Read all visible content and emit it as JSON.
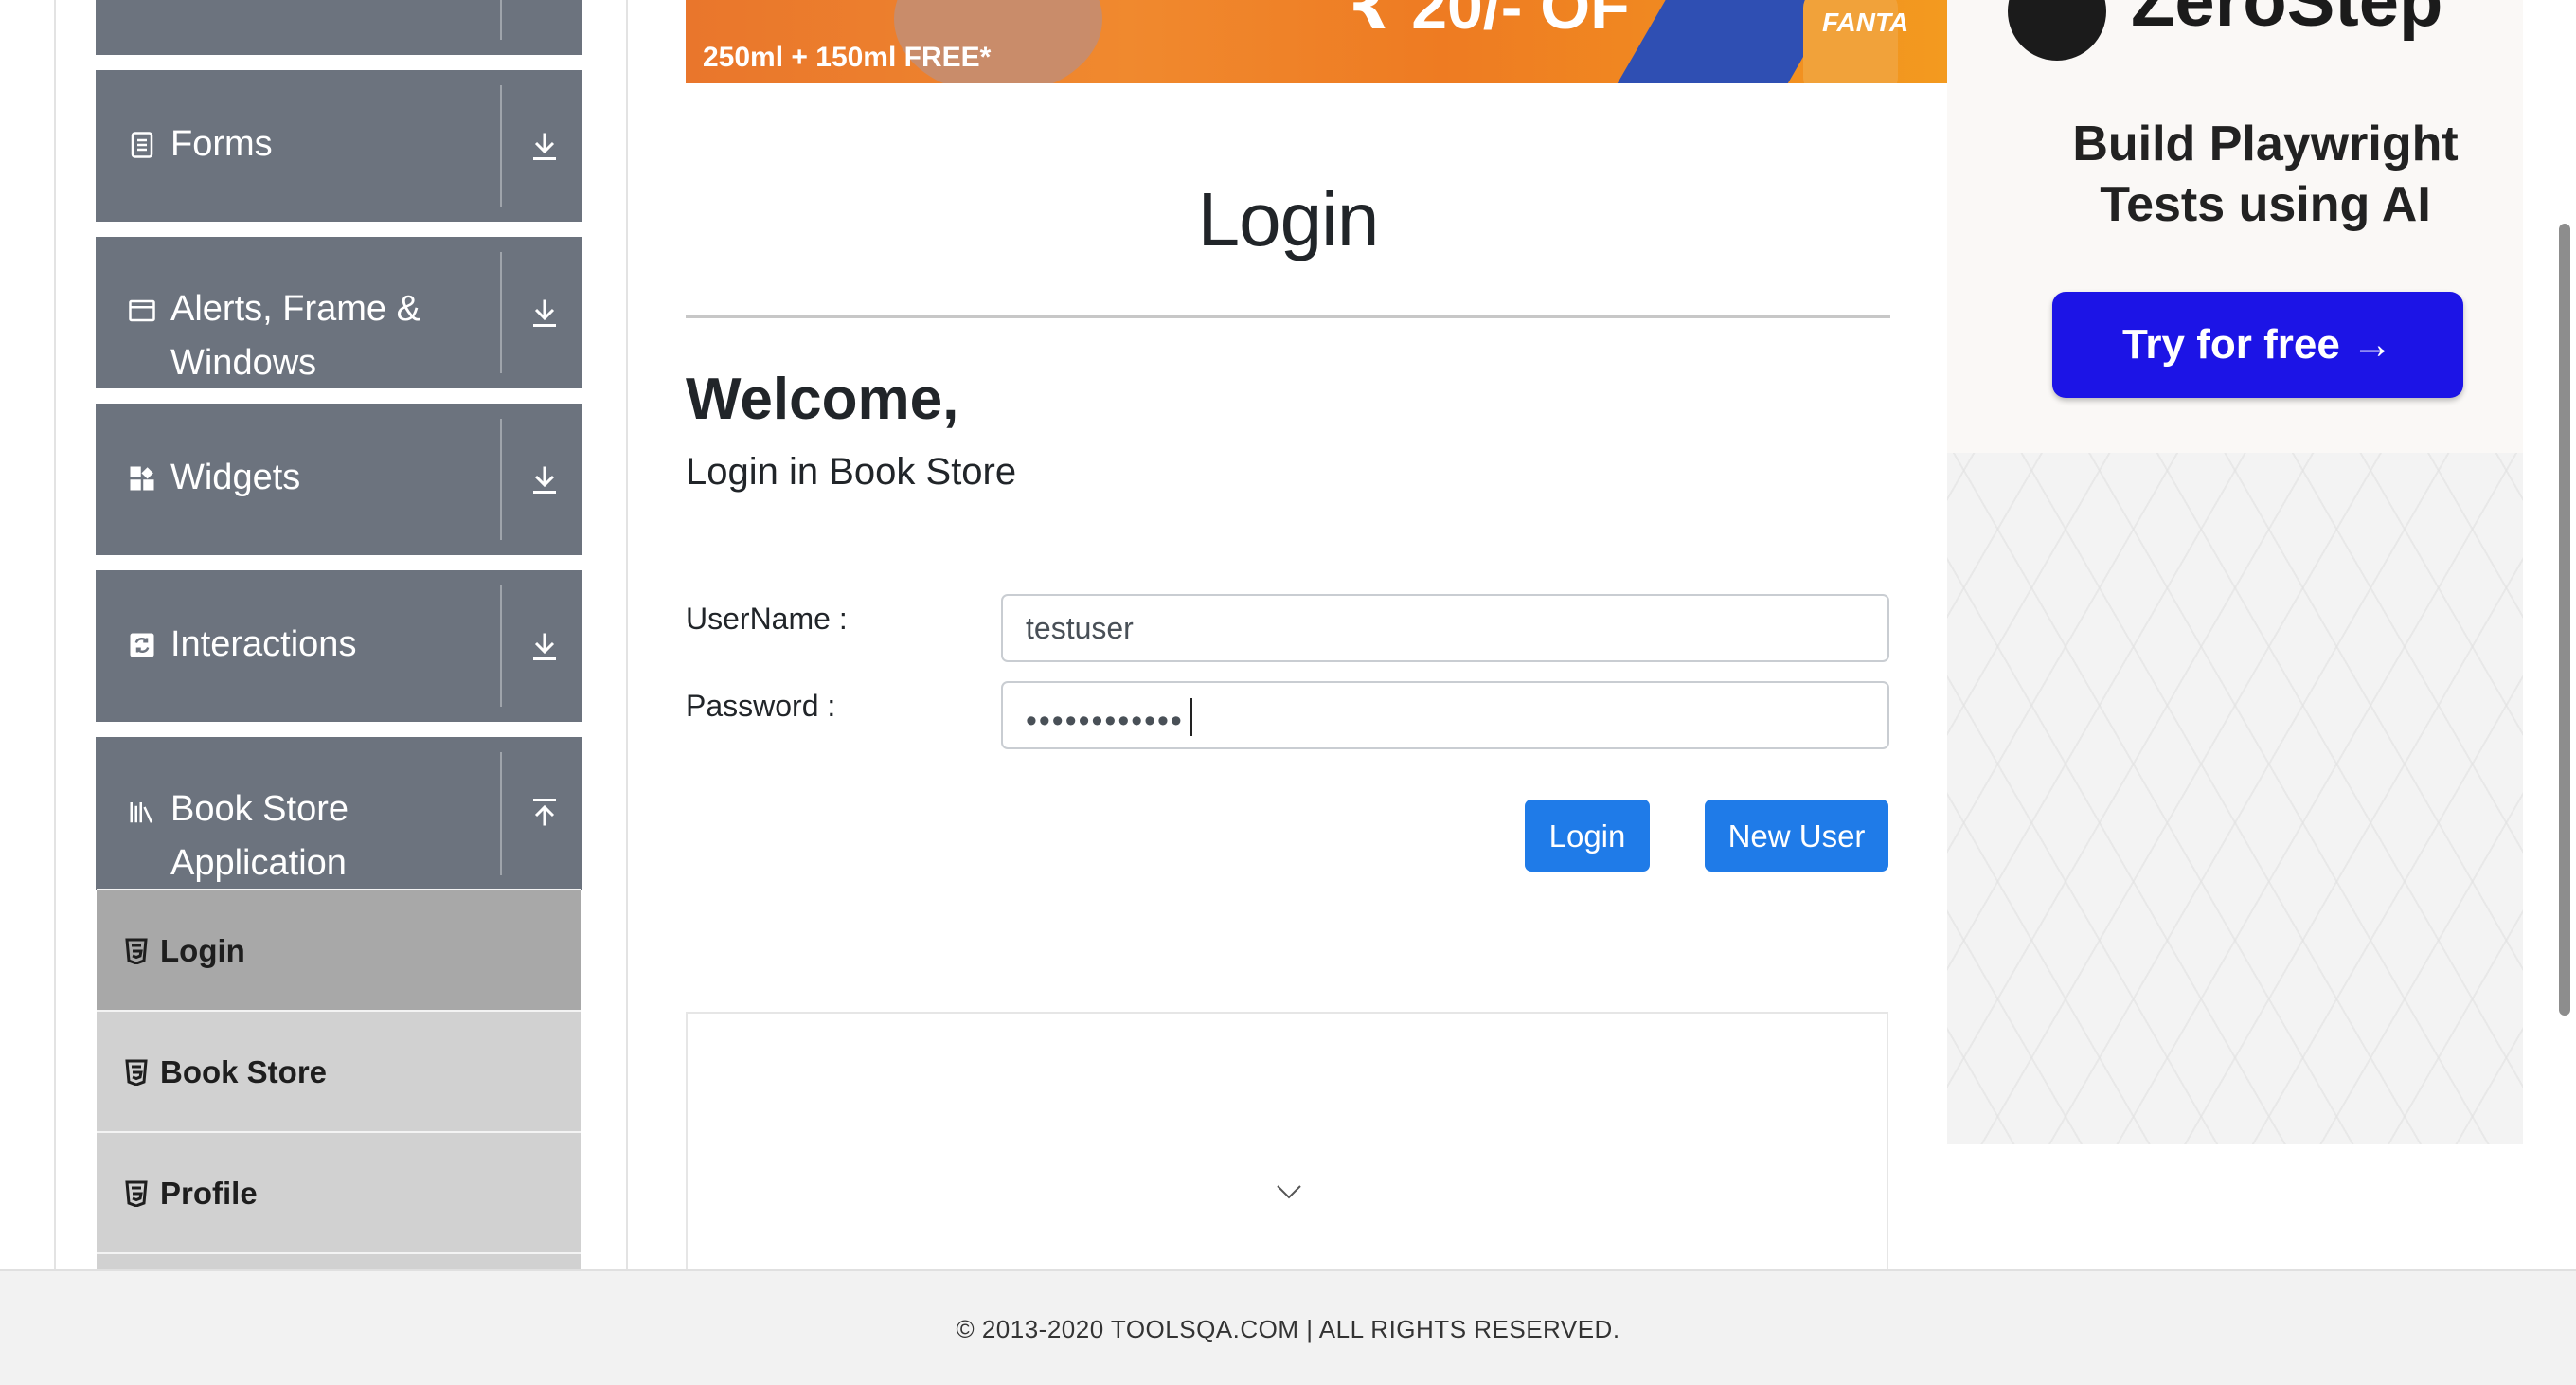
{
  "sidebar": {
    "groups": [
      {
        "label": "Forms",
        "icon": "form-icon",
        "arrow": "download-arrow-icon"
      },
      {
        "label": "Alerts, Frame & Windows",
        "line1": "Alerts, Frame &",
        "line2": "Windows",
        "icon": "window-icon",
        "arrow": "download-arrow-icon"
      },
      {
        "label": "Widgets",
        "icon": "widgets-icon",
        "arrow": "download-arrow-icon"
      },
      {
        "label": "Interactions",
        "icon": "interactions-icon",
        "arrow": "download-arrow-icon"
      },
      {
        "label": "Book Store Application",
        "line1": "Book Store",
        "line2": "Application",
        "icon": "library-icon",
        "arrow": "upload-arrow-icon"
      }
    ],
    "items": [
      {
        "label": "Login",
        "active": true,
        "icon": "html5-icon"
      },
      {
        "label": "Book Store",
        "active": false,
        "icon": "html5-icon"
      },
      {
        "label": "Profile",
        "active": false,
        "icon": "html5-icon"
      }
    ]
  },
  "banner": {
    "free_text": "250ml + 150ml FREE*",
    "price": "₹ 20/- OF",
    "brand": "FANTA"
  },
  "main": {
    "title": "Login",
    "welcome": "Welcome,",
    "subheading": "Login in Book Store",
    "username_label": "UserName :",
    "username_value": "testuser",
    "password_label": "Password :",
    "password_mask": "••••••••••••",
    "login_button": "Login",
    "new_user_button": "New User"
  },
  "ad": {
    "brand": "ZeroStep",
    "headline_line1": "Build Playwright",
    "headline_line2": "Tests using AI",
    "cta": "Try for free →"
  },
  "footer": {
    "text": "© 2013-2020 TOOLSQA.COM | ALL RIGHTS RESERVED."
  },
  "colors": {
    "sidebar_group": "#6c737e",
    "sidebar_item": "#d1d1d1",
    "sidebar_item_active": "#a8a8a8",
    "primary_button": "#1f7be8",
    "ad_button": "#1c14e6",
    "footer_bg": "#f2f2f2"
  }
}
